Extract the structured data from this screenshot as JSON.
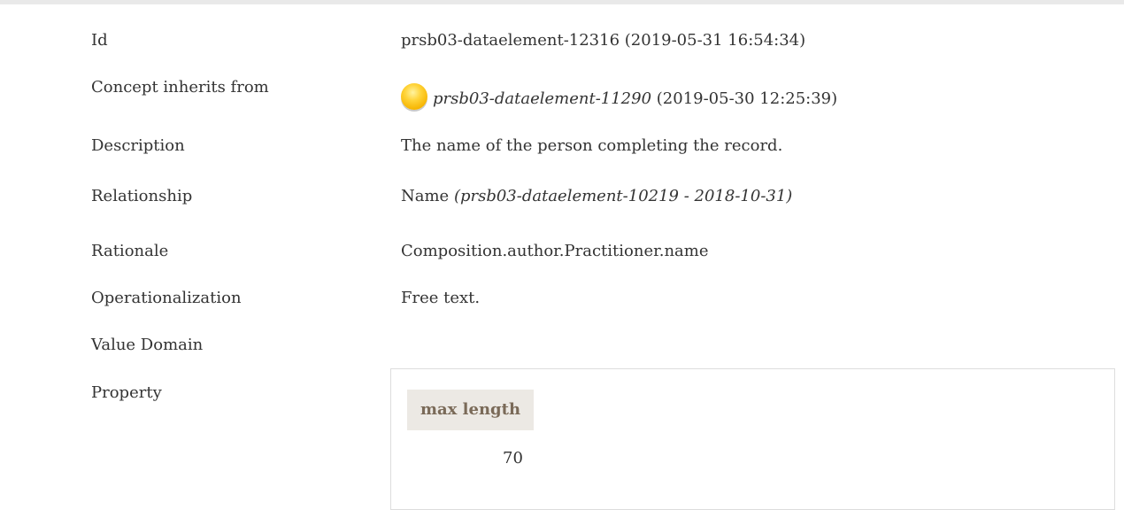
{
  "rows": {
    "id": {
      "label": "Id",
      "value": "prsb03-dataelement-12316 (2019-05-31 16:54:34)"
    },
    "inherits": {
      "label": "Concept inherits from",
      "link": "prsb03-dataelement-11290",
      "date": " (2019-05-30 12:25:39)",
      "status_icon": "yellow-status-circle-icon",
      "status_color": "#f6b400"
    },
    "description": {
      "label": "Description",
      "value": "The name of the person completing the record."
    },
    "relationship": {
      "label": "Relationship",
      "value": "Name ",
      "ref": "(prsb03-dataelement-10219 - 2018-10-31)"
    },
    "rationale": {
      "label": "Rationale",
      "value": "Composition.author.Practitioner.name"
    },
    "operationalization": {
      "label": "Operationalization",
      "value": "Free text."
    },
    "value_domain": {
      "label": "Value Domain"
    },
    "property": {
      "label": "Property",
      "column_header": "max length",
      "column_value": "70"
    }
  }
}
